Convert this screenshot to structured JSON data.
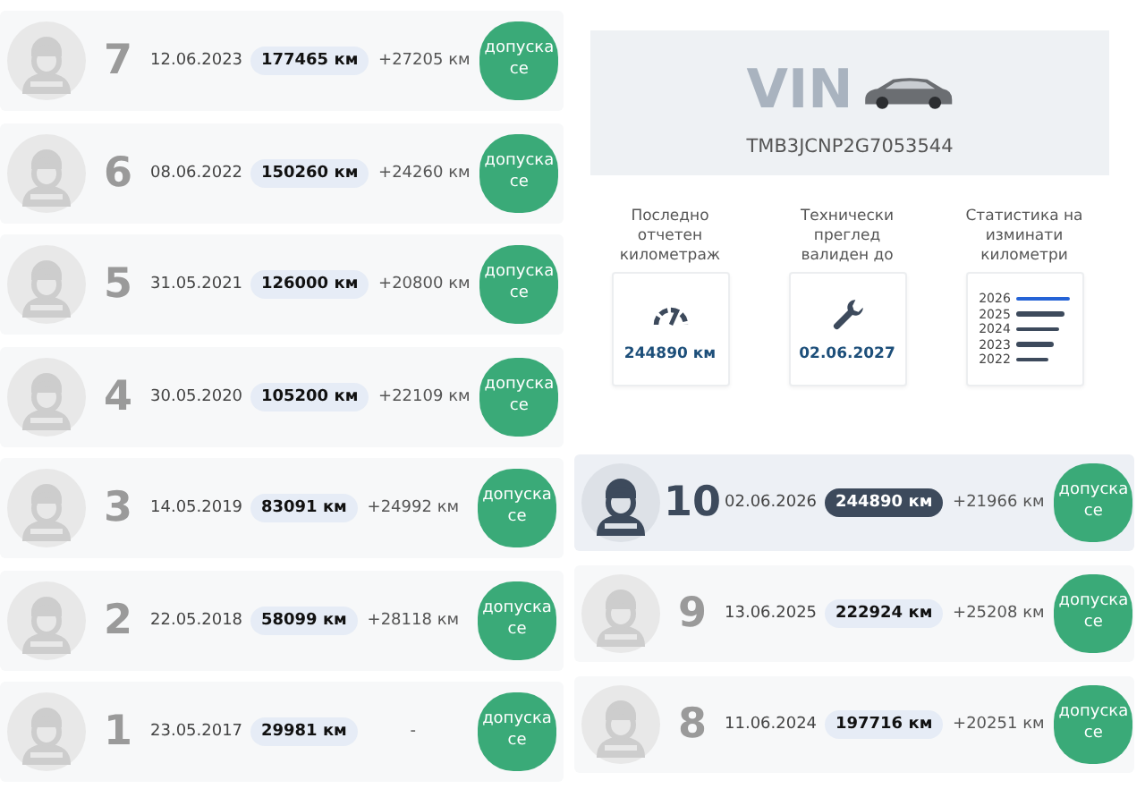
{
  "left_rows": [
    {
      "number": "7",
      "date": "12.06.2023",
      "km": "177465 км",
      "delta": "+27205 км",
      "button": "допуска се",
      "current": false
    },
    {
      "number": "6",
      "date": "08.06.2022",
      "km": "150260 км",
      "delta": "+24260 км",
      "button": "допуска се",
      "current": false
    },
    {
      "number": "5",
      "date": "31.05.2021",
      "km": "126000 км",
      "delta": "+20800 км",
      "button": "допуска се",
      "current": false
    },
    {
      "number": "4",
      "date": "30.05.2020",
      "km": "105200 км",
      "delta": "+22109 км",
      "button": "допуска се",
      "current": false
    },
    {
      "number": "3",
      "date": "14.05.2019",
      "km": "83091 км",
      "delta": "+24992 км",
      "button": "допуска се",
      "current": false
    },
    {
      "number": "2",
      "date": "22.05.2018",
      "km": "58099 км",
      "delta": "+28118 км",
      "button": "допуска се",
      "current": false
    },
    {
      "number": "1",
      "date": "23.05.2017",
      "km": "29981 км",
      "delta": "-",
      "button": "допуска се",
      "current": false
    }
  ],
  "vin": {
    "watermark": "VIN",
    "code": "TMB3JCNP2G7053544"
  },
  "stats": [
    {
      "kind": "gauge",
      "label": "Последно отчетен километраж",
      "value": "244890 км"
    },
    {
      "kind": "wrench",
      "label": "Технически преглед валиден до",
      "value": "02.06.2027"
    },
    {
      "kind": "years",
      "label": "Статистика на изминати километри",
      "years": [
        {
          "year": "2026",
          "highlighted": true
        },
        {
          "year": "2025",
          "highlighted": false
        },
        {
          "year": "2024",
          "highlighted": false
        },
        {
          "year": "2023",
          "highlighted": false
        },
        {
          "year": "2022",
          "highlighted": false
        }
      ]
    }
  ],
  "right_rows": [
    {
      "number": "10",
      "date": "02.06.2026",
      "km": "244890 км",
      "delta": "+21966 км",
      "button": "допуска се",
      "current": true
    },
    {
      "number": "9",
      "date": "13.06.2025",
      "km": "222924 км",
      "delta": "+25208 км",
      "button": "допуска се",
      "current": false
    },
    {
      "number": "8",
      "date": "11.06.2024",
      "km": "197716 км",
      "delta": "+20251 км",
      "button": "допуска се",
      "current": false
    }
  ]
}
